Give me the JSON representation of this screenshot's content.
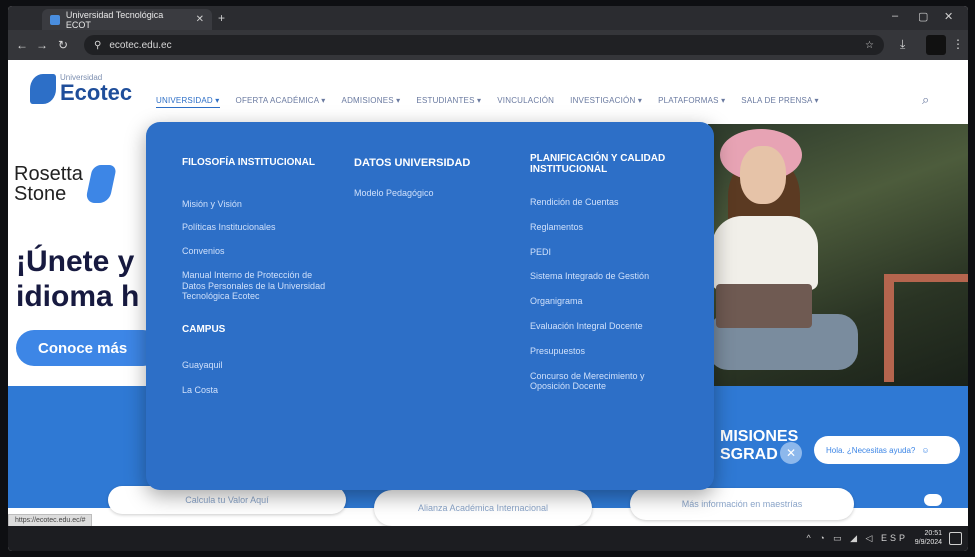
{
  "browser": {
    "tab_title": "Universidad Tecnológica ECOT",
    "tab_close": "✕",
    "new_tab": "+",
    "url": "ecotec.edu.ec",
    "window_controls": [
      "–",
      "▢",
      "✕"
    ],
    "nav_icons": [
      "back-icon",
      "forward-icon",
      "reload-icon",
      "site-info-icon"
    ]
  },
  "site": {
    "logo_small": "Universidad",
    "logo_big": "Ecotec",
    "menu": [
      {
        "label": "UNIVERSIDAD ▾",
        "active": true
      },
      {
        "label": "OFERTA ACADÉMICA ▾",
        "active": false
      },
      {
        "label": "ADMISIONES ▾",
        "active": false
      },
      {
        "label": "ESTUDIANTES ▾",
        "active": false
      },
      {
        "label": "VINCULACIÓN",
        "active": false
      },
      {
        "label": "INVESTIGACIÓN ▾",
        "active": false
      },
      {
        "label": "PLATAFORMAS ▾",
        "active": false
      },
      {
        "label": "SALA DE PRENSA ▾",
        "active": false
      }
    ],
    "search_icon": "⌕"
  },
  "hero": {
    "partner_name_line1": "Rosetta",
    "partner_name_line2": "Stone",
    "title_line1": "¡Únete y",
    "title_line2": "idioma h",
    "cta": "Conoce más"
  },
  "band": {
    "admissions_line1": "MISIONES",
    "admissions_line2": "SGRAD",
    "close_icon": "✕",
    "chat_prompt": "Hola. ¿Necesitas ayuda?",
    "pills": [
      "Calcula tu Valor Aquí",
      "Alianza Académica Internacional",
      "Más información en maestrías"
    ]
  },
  "mega_menu": {
    "col1_heading": "FILOSOFÍA INSTITUCIONAL",
    "col1_items": [
      "Misión y Visión",
      "Políticas Institucionales",
      "Convenios",
      "Manual Interno de Protección de Datos Personales de la Universidad Tecnológica Ecotec"
    ],
    "col1b_heading": "CAMPUS",
    "col1b_items": [
      "Guayaquil",
      "La Costa"
    ],
    "col2_heading": "DATOS UNIVERSIDAD",
    "col2_items": [
      "Modelo Pedagógico"
    ],
    "col3_heading": "PLANIFICACIÓN Y CALIDAD INSTITUCIONAL",
    "col3_items": [
      "Rendición de Cuentas",
      "Reglamentos",
      "PEDI",
      "Sistema Integrado de Gestión",
      "Organigrama",
      "Evaluación Integral Docente",
      "Presupuestos",
      "Concurso de Merecimiento y Oposición Docente"
    ]
  },
  "status": {
    "hover_url": "https://ecotec.edu.ec/#"
  },
  "taskbar": {
    "tray": "^ ◔ ▭ ◢ ◁ ESP",
    "time": "20:51",
    "date": "9/9/2024"
  },
  "colors": {
    "brand_blue": "#2d6fc7",
    "hero_blue": "#3d86e6",
    "navy": "#171a40"
  }
}
